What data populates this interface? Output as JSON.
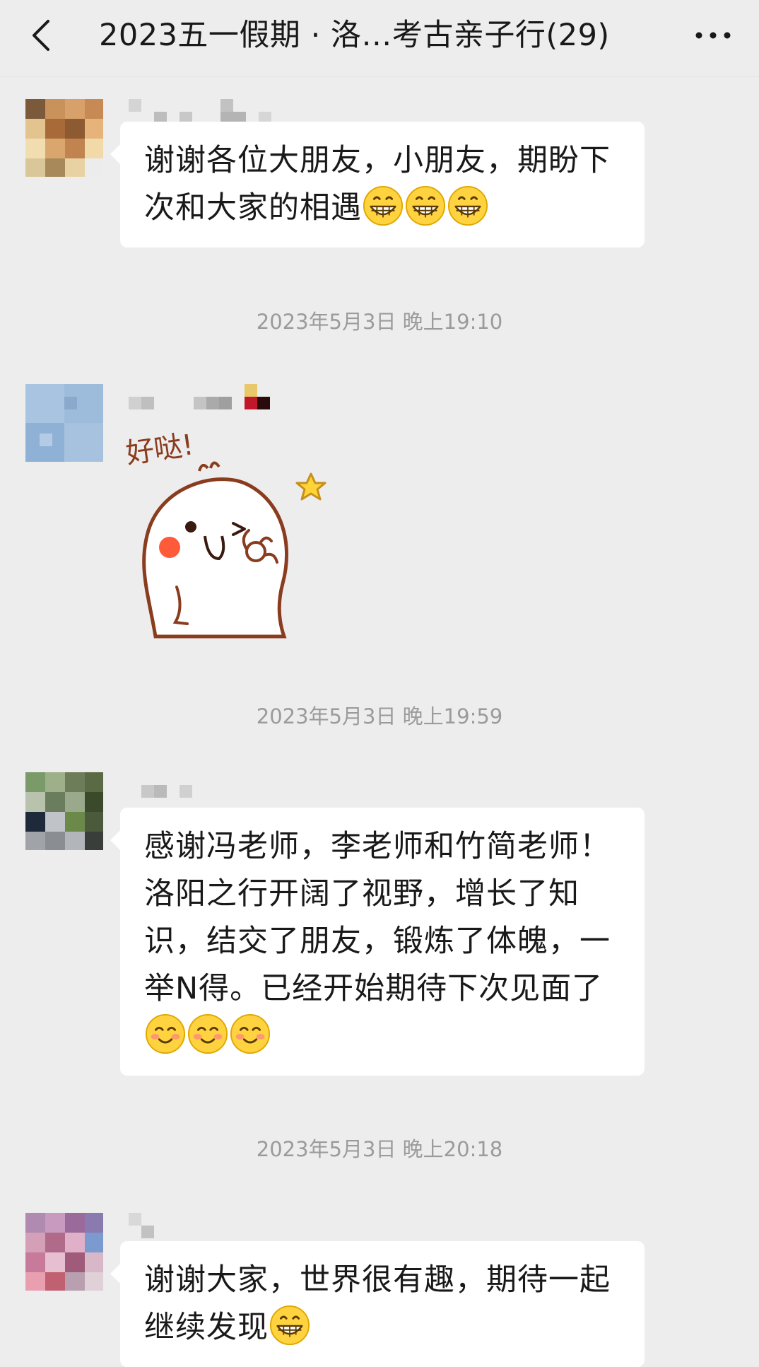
{
  "header": {
    "title": "2023五一假期 · 洛…考古亲子行(29)",
    "back_icon": "chevron-left-icon",
    "more_icon": "more-dots-icon"
  },
  "messages": [
    {
      "text": "谢谢各位大朋友，小朋友，期盼下次和大家的相遇",
      "emoji": "grinning-face"
    },
    {
      "timestamp": "2023年5月3日 晚上19:10",
      "sticker_text": "好哒!"
    },
    {
      "timestamp": "2023年5月3日 晚上19:59",
      "text": "感谢冯老师，李老师和竹简老师！洛阳之行开阔了视野，增长了知识，结交了朋友，锻炼了体魄，一举N得。已经开始期待下次见面了",
      "emoji": "smiling-face-with-smiling-eyes"
    },
    {
      "timestamp": "2023年5月3日 晚上20:18",
      "text": "谢谢大家，世界很有趣，期待一起继续发现",
      "emoji": "grinning-face"
    }
  ],
  "colors": {
    "background": "#ededed",
    "bubble": "#ffffff",
    "timestamp": "#9b9b9b",
    "text": "#191919"
  }
}
